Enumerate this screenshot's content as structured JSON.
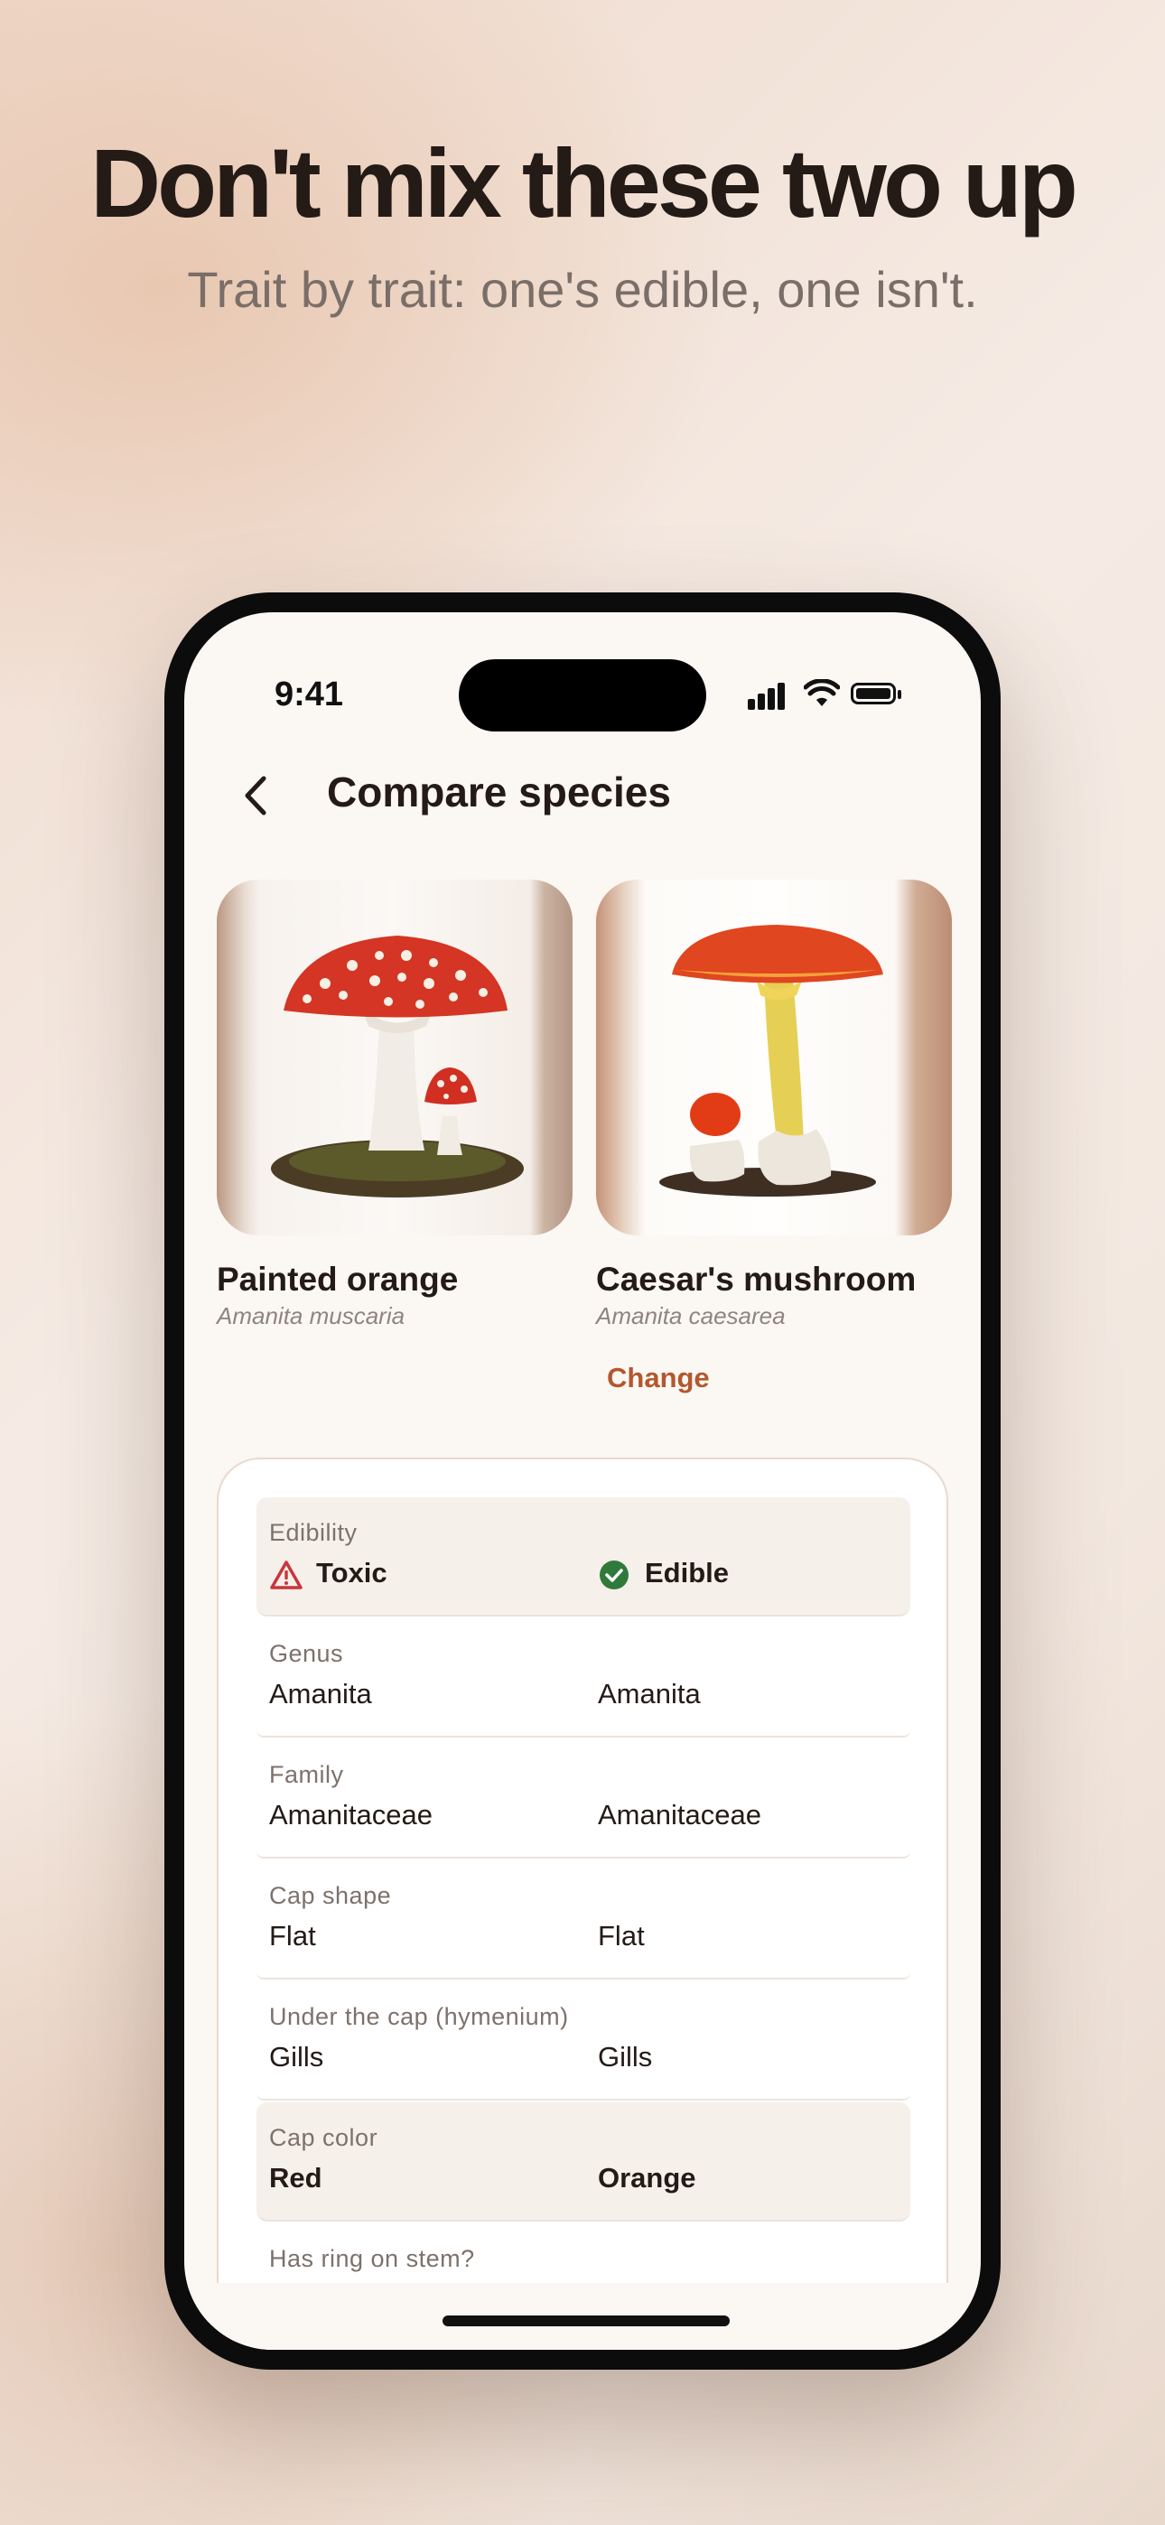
{
  "marketing": {
    "headline": "Don't mix these two up",
    "subheadline": "Trait by trait: one's edible, one isn't."
  },
  "status_bar": {
    "time": "9:41"
  },
  "nav": {
    "title": "Compare species",
    "back_icon": "chevron-left-icon"
  },
  "species": [
    {
      "common_name": "Painted orange",
      "latin_name": "Amanita muscaria"
    },
    {
      "common_name": "Caesar's mushroom",
      "latin_name": "Amanita caesarea"
    }
  ],
  "change_label": "Change",
  "traits": [
    {
      "label": "Edibility",
      "left": "Toxic",
      "right": "Edible",
      "highlighted": true,
      "left_icon": "warning-triangle-icon",
      "right_icon": "check-circle-icon"
    },
    {
      "label": "Genus",
      "left": "Amanita",
      "right": "Amanita",
      "highlighted": false
    },
    {
      "label": "Family",
      "left": "Amanitaceae",
      "right": "Amanitaceae",
      "highlighted": false
    },
    {
      "label": "Cap shape",
      "left": "Flat",
      "right": "Flat",
      "highlighted": false
    },
    {
      "label": "Under the cap (hymenium)",
      "left": "Gills",
      "right": "Gills",
      "highlighted": false
    },
    {
      "label": "Cap color",
      "left": "Red",
      "right": "Orange",
      "highlighted": true
    },
    {
      "label": "Has ring on stem?",
      "left": "",
      "right": "",
      "highlighted": false
    }
  ],
  "colors": {
    "accent": "#b2582e",
    "toxic": "#c9363b",
    "edible": "#2f7a3b",
    "text": "#241a16"
  }
}
